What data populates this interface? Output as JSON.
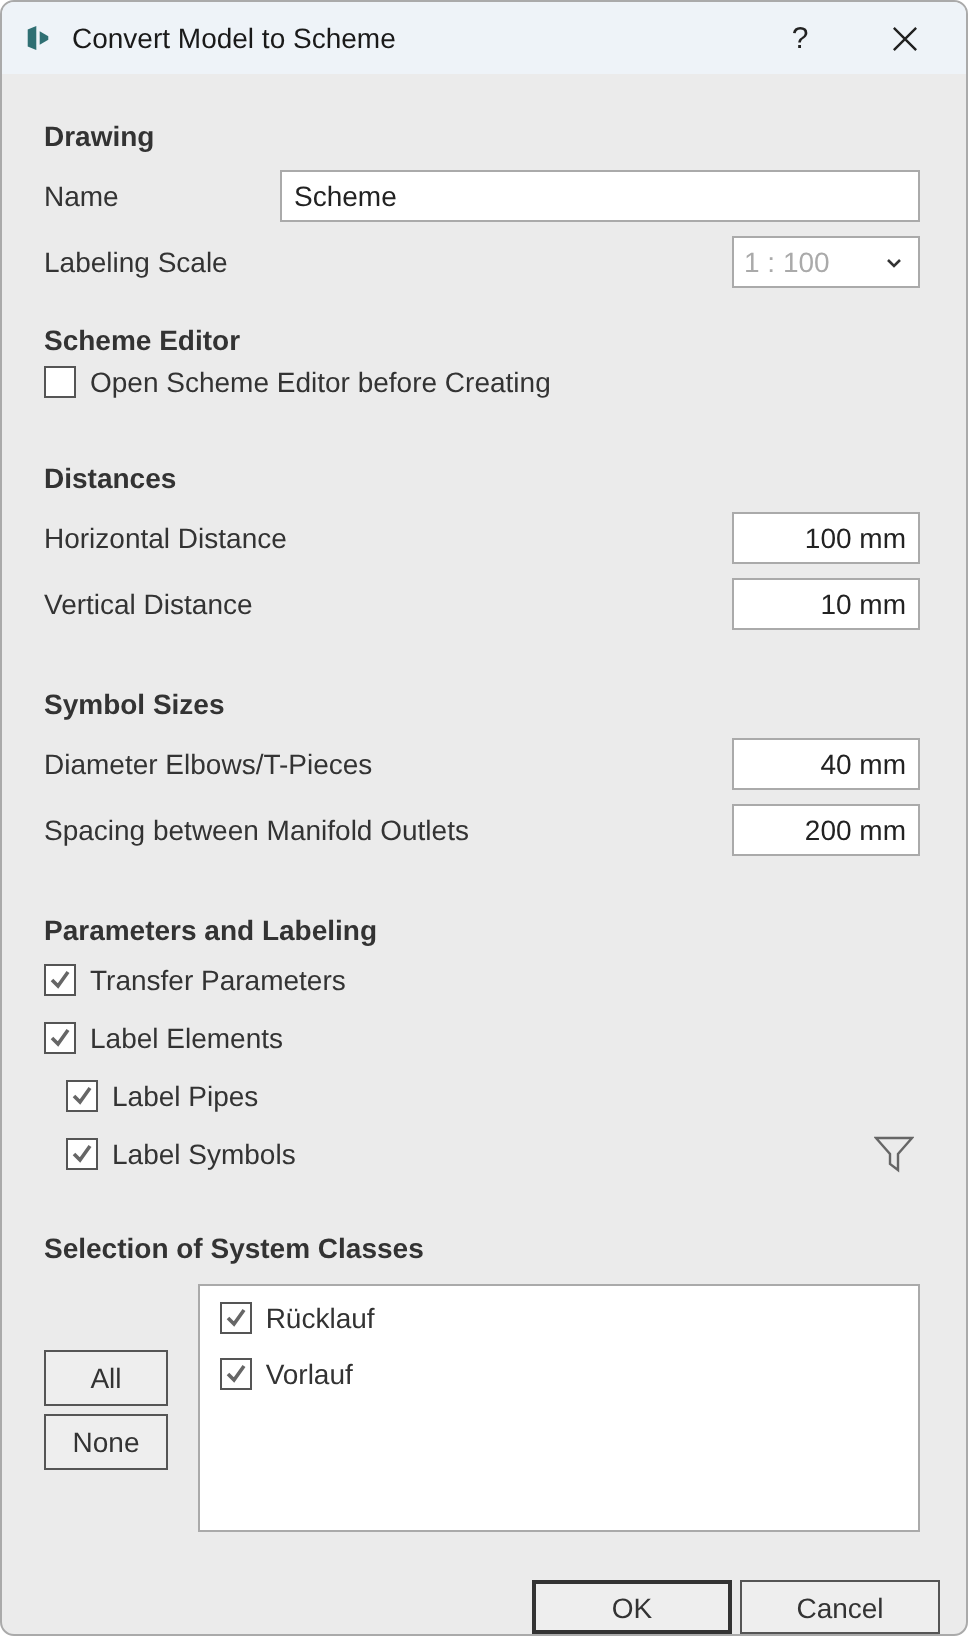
{
  "window": {
    "title": "Convert Model to Scheme",
    "help": "?"
  },
  "drawing": {
    "heading": "Drawing",
    "name": {
      "label": "Name",
      "value": "Scheme"
    },
    "labeling_scale": {
      "label": "Labeling Scale",
      "value": "1 : 100",
      "disabled": true
    }
  },
  "scheme_editor": {
    "heading": "Scheme Editor",
    "option": {
      "label": "Open Scheme Editor before Creating",
      "checked": false
    }
  },
  "distances": {
    "heading": "Distances",
    "fields": [
      {
        "label": "Horizontal Distance",
        "value": "100 mm"
      },
      {
        "label": "Vertical Distance",
        "value": "10 mm"
      }
    ]
  },
  "symbol_sizes": {
    "heading": "Symbol Sizes",
    "fields": [
      {
        "label": "Diameter Elbows/T-Pieces",
        "value": "40 mm"
      },
      {
        "label": "Spacing between Manifold Outlets",
        "value": "200 mm"
      }
    ]
  },
  "parameters": {
    "heading": "Parameters and Labeling",
    "options": [
      {
        "label": "Transfer Parameters",
        "checked": true
      },
      {
        "label": "Label Elements",
        "checked": true,
        "children": [
          {
            "label": "Label Pipes",
            "checked": true
          },
          {
            "label": "Label Symbols",
            "checked": true
          }
        ]
      }
    ]
  },
  "system_classes": {
    "heading": "Selection of System Classes",
    "buttons": [
      "All",
      "None"
    ],
    "items": [
      {
        "label": "Rücklauf",
        "checked": true
      },
      {
        "label": "Vorlauf",
        "checked": true
      }
    ]
  },
  "buttons": [
    {
      "label": "OK",
      "default": true
    },
    {
      "label": "Cancel",
      "default": false
    }
  ]
}
